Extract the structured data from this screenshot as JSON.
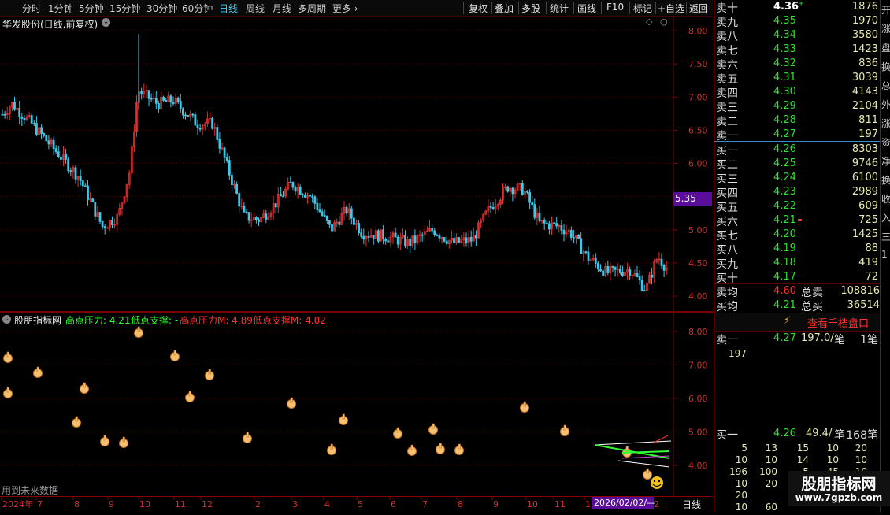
{
  "toolbar": {
    "periods": [
      "分时",
      "1分钟",
      "5分钟",
      "15分钟",
      "30分钟",
      "60分钟",
      "日线",
      "周线",
      "月线",
      "多周期",
      "更多"
    ],
    "active_period": "日线",
    "right_buttons": [
      "复权",
      "叠加",
      "多股",
      "统计",
      "画线",
      "F10",
      "标记",
      "+自选",
      "返回"
    ]
  },
  "main_chart": {
    "stock_title": "华发股份(日线,前复权)",
    "current_price_tag": "5.35",
    "y_ticks": [
      "8.00",
      "7.50",
      "7.00",
      "6.50",
      "6.00",
      "5.50",
      "5.00",
      "4.50",
      "4.00"
    ],
    "up_color": "#e03030",
    "down_color": "#3ec8e8"
  },
  "sub_chart": {
    "indicator_name": "股朋指标网",
    "legend": [
      {
        "text": "高点压力: 4.21",
        "color": "#33ff33"
      },
      {
        "text": "低点支撑: -",
        "color": "#33ff33"
      },
      {
        "text": "高点压力M: 4.89",
        "color": "#ff3333"
      },
      {
        "text": "低点支撑M: 4.02",
        "color": "#ff3333"
      }
    ],
    "y_ticks": [
      "8.00",
      "7.00",
      "6.00",
      "5.00",
      "4.00"
    ],
    "future_data_note": "用到未来数据"
  },
  "time_axis": {
    "labels": [
      "2024年",
      "7",
      "8",
      "9",
      "10",
      "11",
      "12",
      "2",
      "3",
      "4",
      "5",
      "6",
      "7",
      "8",
      "9",
      "10",
      "11",
      "1",
      "2"
    ],
    "cursor_date": "2026/02/02/—",
    "period_label": "日线"
  },
  "order_book": {
    "asks": [
      {
        "label": "卖十",
        "price": "4.36",
        "vol": "1876"
      },
      {
        "label": "卖九",
        "price": "4.35",
        "vol": "1970"
      },
      {
        "label": "卖八",
        "price": "4.34",
        "vol": "3580"
      },
      {
        "label": "卖七",
        "price": "4.33",
        "vol": "1423"
      },
      {
        "label": "卖六",
        "price": "4.32",
        "vol": "836"
      },
      {
        "label": "卖五",
        "price": "4.31",
        "vol": "3039"
      },
      {
        "label": "卖四",
        "price": "4.30",
        "vol": "4143"
      },
      {
        "label": "卖三",
        "price": "4.29",
        "vol": "2104"
      },
      {
        "label": "卖二",
        "price": "4.28",
        "vol": "811"
      },
      {
        "label": "卖一",
        "price": "4.27",
        "vol": "197"
      }
    ],
    "bids": [
      {
        "label": "买一",
        "price": "4.26",
        "vol": "8303"
      },
      {
        "label": "买二",
        "price": "4.25",
        "vol": "9746"
      },
      {
        "label": "买三",
        "price": "4.24",
        "vol": "6100"
      },
      {
        "label": "买四",
        "price": "4.23",
        "vol": "2989"
      },
      {
        "label": "买五",
        "price": "4.22",
        "vol": "609"
      },
      {
        "label": "买六",
        "price": "4.21",
        "vol": "725"
      },
      {
        "label": "买七",
        "price": "4.20",
        "vol": "1425"
      },
      {
        "label": "买八",
        "price": "4.19",
        "vol": "88"
      },
      {
        "label": "买九",
        "price": "4.18",
        "vol": "419"
      },
      {
        "label": "买十",
        "price": "4.17",
        "vol": "72"
      }
    ],
    "avg_sell": {
      "label": "卖均",
      "price": "4.60",
      "total_label": "总卖",
      "total": "108816"
    },
    "avg_buy": {
      "label": "买均",
      "price": "4.21",
      "total_label": "总买",
      "total": "36514"
    },
    "thousand_button": "查看千档盘口",
    "sell1_detail": {
      "label": "卖一",
      "price": "4.27",
      "avg": "197.0/",
      "unit": "笔",
      "count": "1笔",
      "queue": "197"
    },
    "buy1_detail": {
      "label": "买一",
      "price": "4.26",
      "avg": "49.4/",
      "unit": "笔",
      "count": "168笔"
    },
    "queue_rows": [
      [
        "5",
        "13",
        "15",
        "10",
        "20"
      ],
      [
        "10",
        "10",
        "14",
        "10",
        "10"
      ],
      [
        "196",
        "100",
        "5",
        "45",
        "10"
      ],
      [
        "10",
        "20",
        "",
        "",
        ""
      ],
      [
        "20",
        "",
        "",
        "",
        ""
      ],
      [
        "10",
        "60",
        "",
        "",
        ""
      ]
    ]
  },
  "right_strip_chars": [
    "开",
    "涨",
    "盘",
    "换",
    "总",
    "外",
    "涨",
    "资",
    "净",
    "换",
    "收",
    "入",
    "三",
    "1"
  ],
  "watermark": {
    "title": "股朋指标网",
    "url": "www.7gpzb.com"
  }
}
